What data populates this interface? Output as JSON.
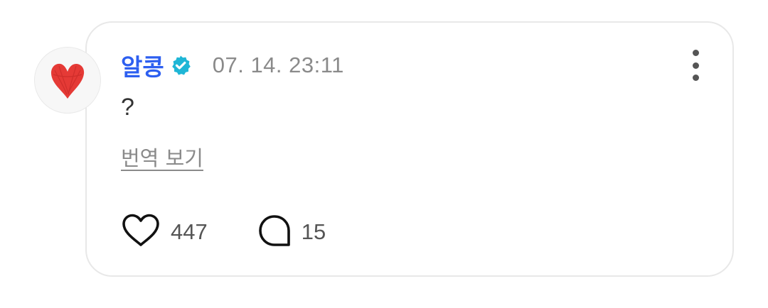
{
  "comment": {
    "username": "알콩",
    "verified": true,
    "timestamp": "07. 14. 23:11",
    "text": "?",
    "translate_label": "번역 보기",
    "likes": "447",
    "replies": "15"
  },
  "icons": {
    "avatar": "red-heart-drawing",
    "verified": "verified-badge-icon",
    "more": "more-vertical-icon",
    "like": "heart-outline-icon",
    "reply": "speech-bubble-icon"
  },
  "colors": {
    "username": "#2d5ff0",
    "verified_badge": "#1fb6d6",
    "avatar_heart": "#e53a36",
    "secondary_text": "#8a8a8a",
    "card_border": "#e8e8e8"
  }
}
